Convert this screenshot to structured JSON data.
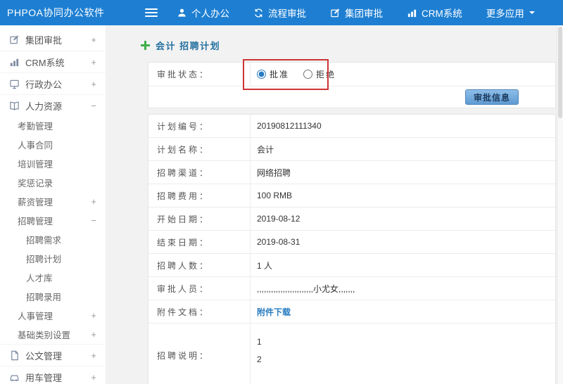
{
  "app": {
    "title": "PHPOA协同办公软件"
  },
  "topnav": {
    "items": [
      {
        "label": "个人办公",
        "icon": "user-icon"
      },
      {
        "label": "流程审批",
        "icon": "flow-icon"
      },
      {
        "label": "集团审批",
        "icon": "edit-icon"
      },
      {
        "label": "CRM系统",
        "icon": "chart-icon"
      },
      {
        "label": "更多应用",
        "icon": "caret-down-icon"
      }
    ]
  },
  "sidebar": {
    "items": [
      {
        "label": "集团审批",
        "icon": "edit-icon",
        "expander": "+",
        "level": 0
      },
      {
        "label": "CRM系统",
        "icon": "chart-icon",
        "expander": "+",
        "level": 0
      },
      {
        "label": "行政办公",
        "icon": "office-icon",
        "expander": "+",
        "level": 0
      },
      {
        "label": "人力资源",
        "icon": "book-icon",
        "expander": "−",
        "level": 0
      },
      {
        "label": "考勤管理",
        "level": 1
      },
      {
        "label": "人事合同",
        "level": 1
      },
      {
        "label": "培训管理",
        "level": 1
      },
      {
        "label": "奖惩记录",
        "level": 1
      },
      {
        "label": "薪资管理",
        "expander": "+",
        "level": 1
      },
      {
        "label": "招聘管理",
        "expander": "−",
        "level": 1
      },
      {
        "label": "招聘需求",
        "level": 2
      },
      {
        "label": "招聘计划",
        "level": 2
      },
      {
        "label": "人才库",
        "level": 2
      },
      {
        "label": "招聘录用",
        "level": 2
      },
      {
        "label": "人事管理",
        "expander": "+",
        "level": 1
      },
      {
        "label": "基础类别设置",
        "expander": "+",
        "level": 1
      },
      {
        "label": "公文管理",
        "icon": "doc-icon",
        "expander": "+",
        "level": 0
      },
      {
        "label": "用车管理",
        "icon": "car-icon",
        "expander": "+",
        "level": 0
      }
    ]
  },
  "content": {
    "page_title": "会计 招聘计划",
    "status": {
      "label": "审批状态：",
      "options": [
        {
          "label": "批准",
          "checked": "checked"
        },
        {
          "label": "拒绝"
        }
      ]
    },
    "approve_button": "审批信息",
    "rows": [
      {
        "label": "计划编号：",
        "value": "20190812111340"
      },
      {
        "label": "计划名称：",
        "value": "会计"
      },
      {
        "label": "招聘渠道：",
        "value": "网络招聘"
      },
      {
        "label": "招聘费用：",
        "value": "100 RMB"
      },
      {
        "label": "开始日期：",
        "value": "2019-08-12"
      },
      {
        "label": "结束日期：",
        "value": "2019-08-31"
      },
      {
        "label": "招聘人数：",
        "value": "1 人"
      },
      {
        "label": "审批人员：",
        "value": ",,,,,,,,,,,,,,,,,,,,,,,,小尤女,,,,,,,"
      },
      {
        "label": "附件文档：",
        "value": "附件下载"
      },
      {
        "label": "招聘说明：",
        "line1": "1",
        "line2": "2"
      }
    ]
  }
}
